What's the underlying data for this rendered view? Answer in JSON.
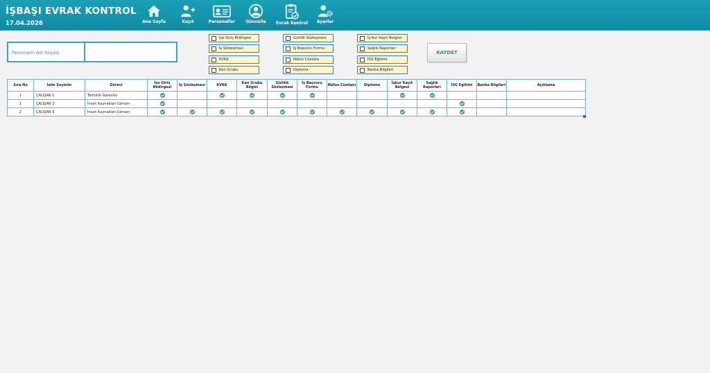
{
  "app": {
    "title": "İŞBAŞI EVRAK KONTROL",
    "date": "17.04.2026"
  },
  "nav": [
    {
      "label": "Ana Sayfa",
      "icon": "home-icon"
    },
    {
      "label": "Kayıt",
      "icon": "add-user-icon"
    },
    {
      "label": "Personeller",
      "icon": "id-card-icon"
    },
    {
      "label": "Güncelle",
      "icon": "update-user-icon"
    },
    {
      "label": "Evrak Kontrol",
      "icon": "clipboard-check-icon"
    },
    {
      "label": "Ayarlar",
      "icon": "user-settings-icon"
    }
  ],
  "form": {
    "name_label": "Personelin Adı Soyadı",
    "name_value": "",
    "save_label": "KAYDET",
    "checkboxes": [
      "İşe Giriş Bildirgesi",
      "İş Sözleşmesi",
      "KVKK",
      "Kan Grubu",
      "Gizlilik Sözleşmesi",
      "İş Başvuru Formu",
      "Nüfus Cüzdanı",
      "Diploma",
      "İş-Kur Kayıt Belgesi",
      "Sağlık Raporları",
      "İSG Eğitimi",
      "Banka Bilgileri"
    ]
  },
  "table": {
    "headers": [
      "Sıra No",
      "İsim Soyisim",
      "Görevi",
      "İşe Giriş Bildirgesi",
      "İş Sözleşmesi",
      "KVKK",
      "Kan Grubu Bilgisi",
      "Gizlilik Sözleşmesi",
      "İş Başvuru Formu",
      "Nüfus Cüzdanı",
      "Diploma",
      "İşkur Kayıt Belgesi",
      "Sağlık Raporları",
      "İSG Eğitimi",
      "Banka Bilgileri",
      "Açıklama"
    ],
    "rows": [
      {
        "no": "1",
        "name": "ÇALIŞAN 1",
        "role": "Temizlik Görevlisi",
        "docs": [
          true,
          false,
          true,
          true,
          true,
          true,
          false,
          false,
          true,
          true,
          false,
          false
        ],
        "note": ""
      },
      {
        "no": "1",
        "name": "ÇALIŞAN 2",
        "role": "İnsan Kaynakları Uzmanı",
        "docs": [
          true,
          false,
          false,
          false,
          false,
          false,
          false,
          false,
          false,
          false,
          true,
          false
        ],
        "note": ""
      },
      {
        "no": "2",
        "name": "ÇALIŞAN 9",
        "role": "İnsan Kaynakları Uzmanı",
        "docs": [
          true,
          true,
          true,
          true,
          true,
          true,
          true,
          true,
          true,
          true,
          true,
          false
        ],
        "note": ""
      }
    ]
  },
  "colors": {
    "header": "#1299b0",
    "check": "#3b9b79",
    "border": "#6fb0de",
    "checkbox_bg": "#fbf6c8"
  }
}
